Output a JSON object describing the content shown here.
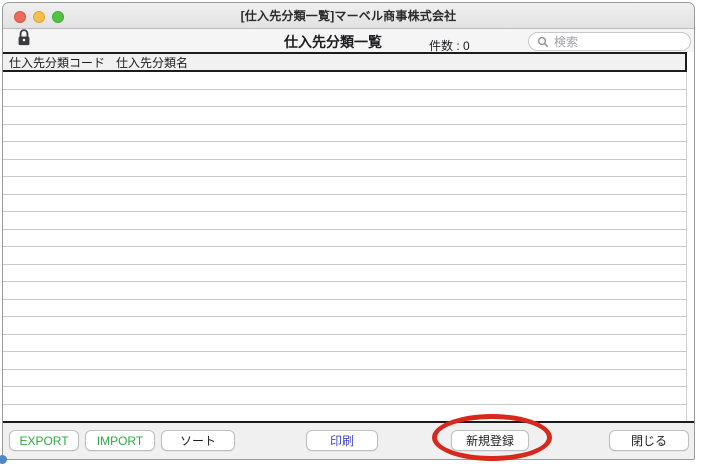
{
  "window": {
    "title": "[仕入先分類一覧]マーベル商事株式会社"
  },
  "toolbar": {
    "title": "仕入先分類一覧",
    "count_label": "件数 :",
    "count_value": "0",
    "search_placeholder": "検索",
    "icons": [
      "lock-icon",
      "search-icon"
    ]
  },
  "table": {
    "columns": [
      {
        "label": "仕入先分類コード"
      },
      {
        "label": "仕入先分類名"
      }
    ],
    "rows": [],
    "visible_empty_rows": 20
  },
  "footer": {
    "buttons": [
      {
        "id": "export",
        "label": "EXPORT",
        "color": "#2fa848"
      },
      {
        "id": "import",
        "label": "IMPORT",
        "color": "#2fa848"
      },
      {
        "id": "sort",
        "label": "ソート",
        "color": "#1d1d1f"
      },
      {
        "id": "print",
        "label": "印刷",
        "color": "#4146c9"
      },
      {
        "id": "new",
        "label": "新規登録",
        "color": "#1d1d1f",
        "annotated": true
      },
      {
        "id": "close",
        "label": "閉じる",
        "color": "#1d1d1f"
      }
    ]
  },
  "annotation": {
    "type": "red-ellipse",
    "color": "#d7281d",
    "target": "新規登録"
  },
  "colors": {
    "titlebar_bg": "#ececec",
    "toolbar_bg": "#f5f5f5",
    "list_border": "#1c1c1c",
    "row_separator": "#c9c9c9",
    "footer_bg": "#f0f0f0",
    "traffic_red": "#ec6a5e",
    "traffic_yellow": "#f5bf4f",
    "traffic_green": "#53c143"
  }
}
